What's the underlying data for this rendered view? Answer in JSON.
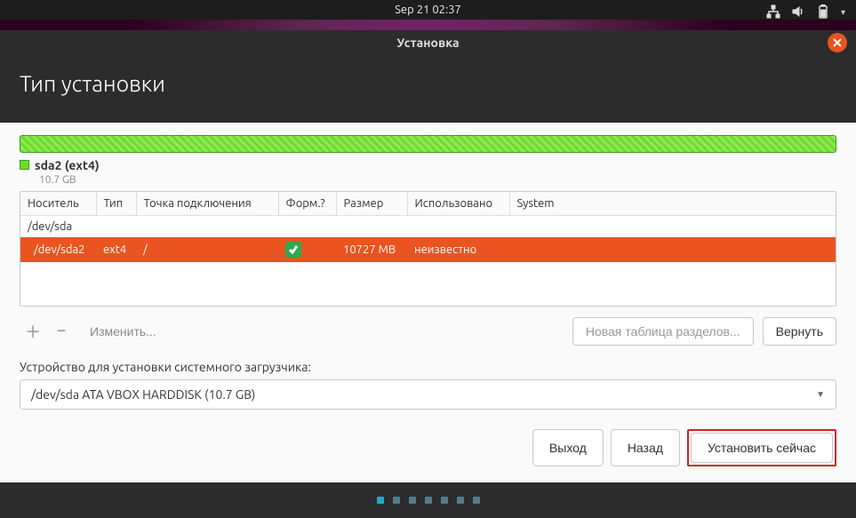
{
  "topbar": {
    "datetime": "Sep 21  02:37"
  },
  "window": {
    "title": "Установка"
  },
  "heading": "Тип установки",
  "partition": {
    "name": "sda2 (ext4)",
    "size": "10.7 GB"
  },
  "table": {
    "headers": {
      "device": "Носитель",
      "type": "Тип",
      "mount": "Точка подключения",
      "format": "Форм.?",
      "size": "Размер",
      "used": "Использовано",
      "system": "System"
    },
    "rows": [
      {
        "device": "/dev/sda",
        "type": "",
        "mount": "",
        "format": "",
        "size": "",
        "used": "",
        "system": "",
        "selected": false
      },
      {
        "device": "/dev/sda2",
        "type": "ext4",
        "mount": "/",
        "format": "check",
        "size": "10727 MB",
        "used": "неизвестно",
        "system": "",
        "selected": true
      }
    ]
  },
  "actions": {
    "change": "Изменить...",
    "new_table": "Новая таблица разделов...",
    "revert": "Вернуть"
  },
  "bootloader": {
    "label": "Устройство для установки системного загрузчика:",
    "value": "/dev/sda   ATA VBOX HARDDISK (10.7 GB)"
  },
  "nav": {
    "quit": "Выход",
    "back": "Назад",
    "install": "Установить сейчас"
  }
}
